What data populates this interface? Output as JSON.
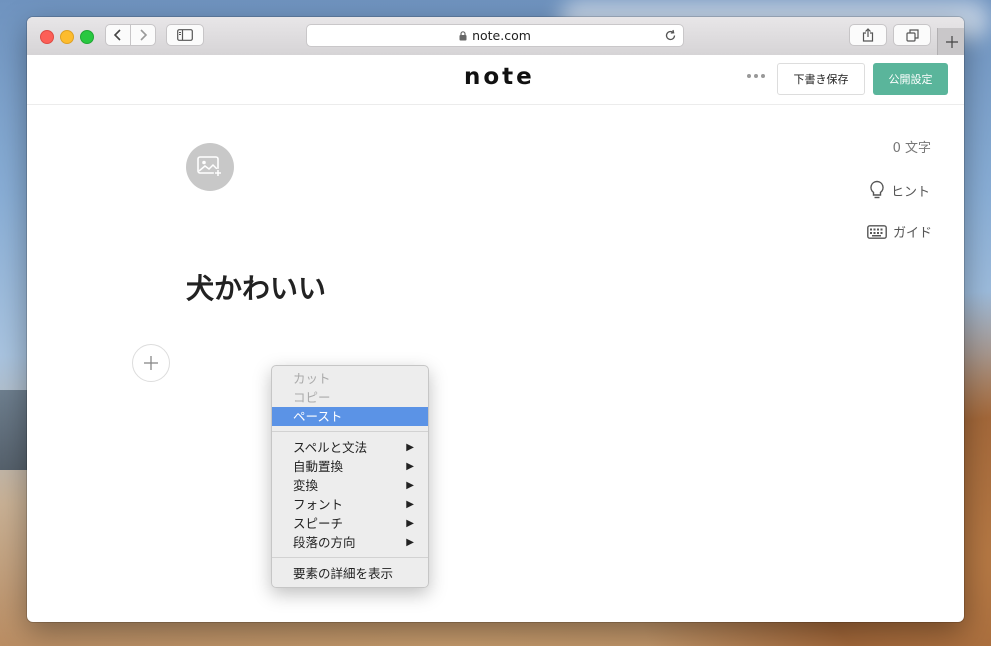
{
  "browser": {
    "url": "note.com"
  },
  "header": {
    "logo": "note",
    "draft_save": "下書き保存",
    "publish_settings": "公開設定"
  },
  "sidebar_right": {
    "word_count": "0 文字",
    "hint": "ヒント",
    "guide": "ガイド"
  },
  "editor": {
    "title": "犬かわいい"
  },
  "context_menu": {
    "items": [
      {
        "label": "カット",
        "state": "disabled"
      },
      {
        "label": "コピー",
        "state": "disabled"
      },
      {
        "label": "ペースト",
        "state": "selected"
      },
      {
        "label": "スペルと文法",
        "submenu": true
      },
      {
        "label": "自動置換",
        "submenu": true
      },
      {
        "label": "変換",
        "submenu": true
      },
      {
        "label": "フォント",
        "submenu": true
      },
      {
        "label": "スピーチ",
        "submenu": true
      },
      {
        "label": "段落の方向",
        "submenu": true
      },
      {
        "label": "要素の詳細を表示"
      }
    ],
    "submenu_glyph": "▶"
  },
  "colors": {
    "accent_green": "#5ab59b",
    "menu_highlight": "#5b93e6"
  }
}
